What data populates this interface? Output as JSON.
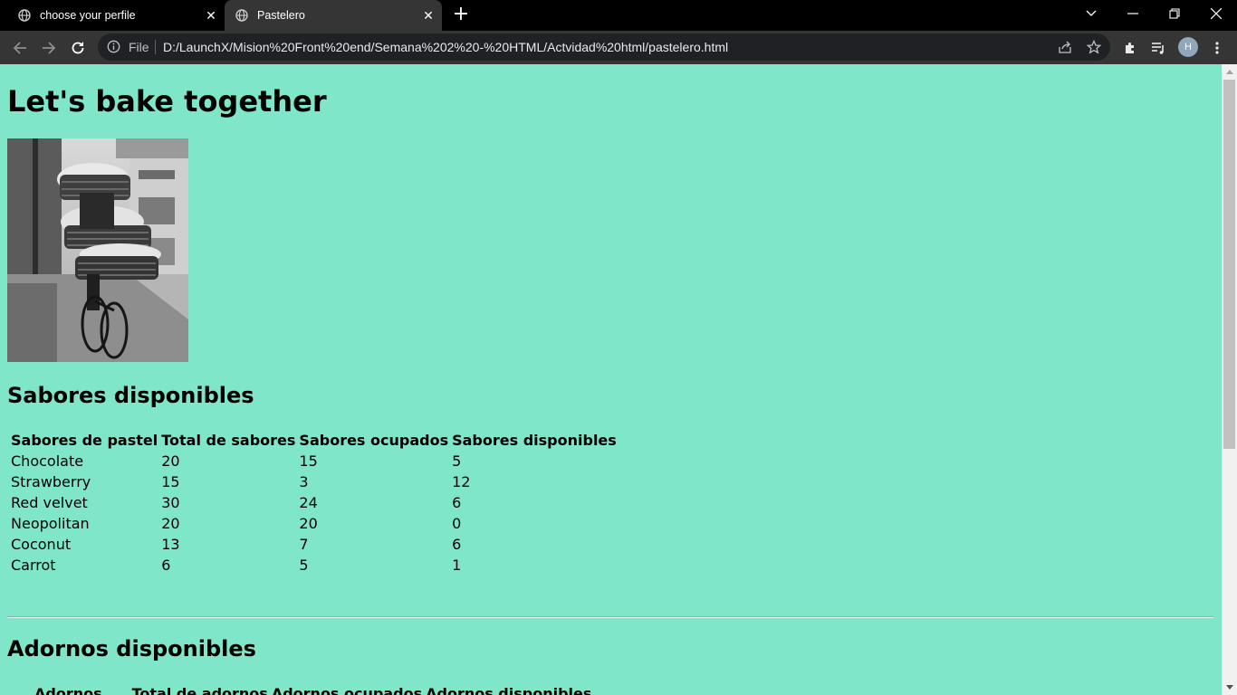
{
  "browser": {
    "tabs": [
      {
        "title": "choose your perfile",
        "active": false
      },
      {
        "title": "Pastelero",
        "active": true
      }
    ],
    "address": {
      "scheme_label": "File",
      "url": "D:/LaunchX/Mision%20Front%20end/Semana%202%20-%20HTML/Actvidad%20html/pastelero.html"
    },
    "profile_initial": "H",
    "colors": {
      "chrome": "#000000",
      "toolbar": "#353535",
      "omnibox": "#202124"
    }
  },
  "page": {
    "background": "#7fe6c9",
    "heading": "Let's bake together",
    "image_alt": "Black and white photo of a baker riding a bicycle with stacked bread baskets",
    "flavors": {
      "heading": "Sabores disponibles",
      "columns": [
        "Sabores de pastel",
        "Total de sabores",
        "Sabores ocupados",
        "Sabores disponibles"
      ],
      "rows": [
        [
          "Chocolate",
          "20",
          "15",
          "5"
        ],
        [
          "Strawberry",
          "15",
          "3",
          "12"
        ],
        [
          "Red velvet",
          "30",
          "24",
          "6"
        ],
        [
          "Neopolitan",
          "20",
          "20",
          "0"
        ],
        [
          "Coconut",
          "13",
          "7",
          "6"
        ],
        [
          "Carrot",
          "6",
          "5",
          "1"
        ]
      ]
    },
    "decorations": {
      "heading": "Adornos disponibles",
      "columns": [
        "Adornos",
        "Total de adornos",
        "Adornos ocupados",
        "Adornos disponibles"
      ]
    }
  }
}
